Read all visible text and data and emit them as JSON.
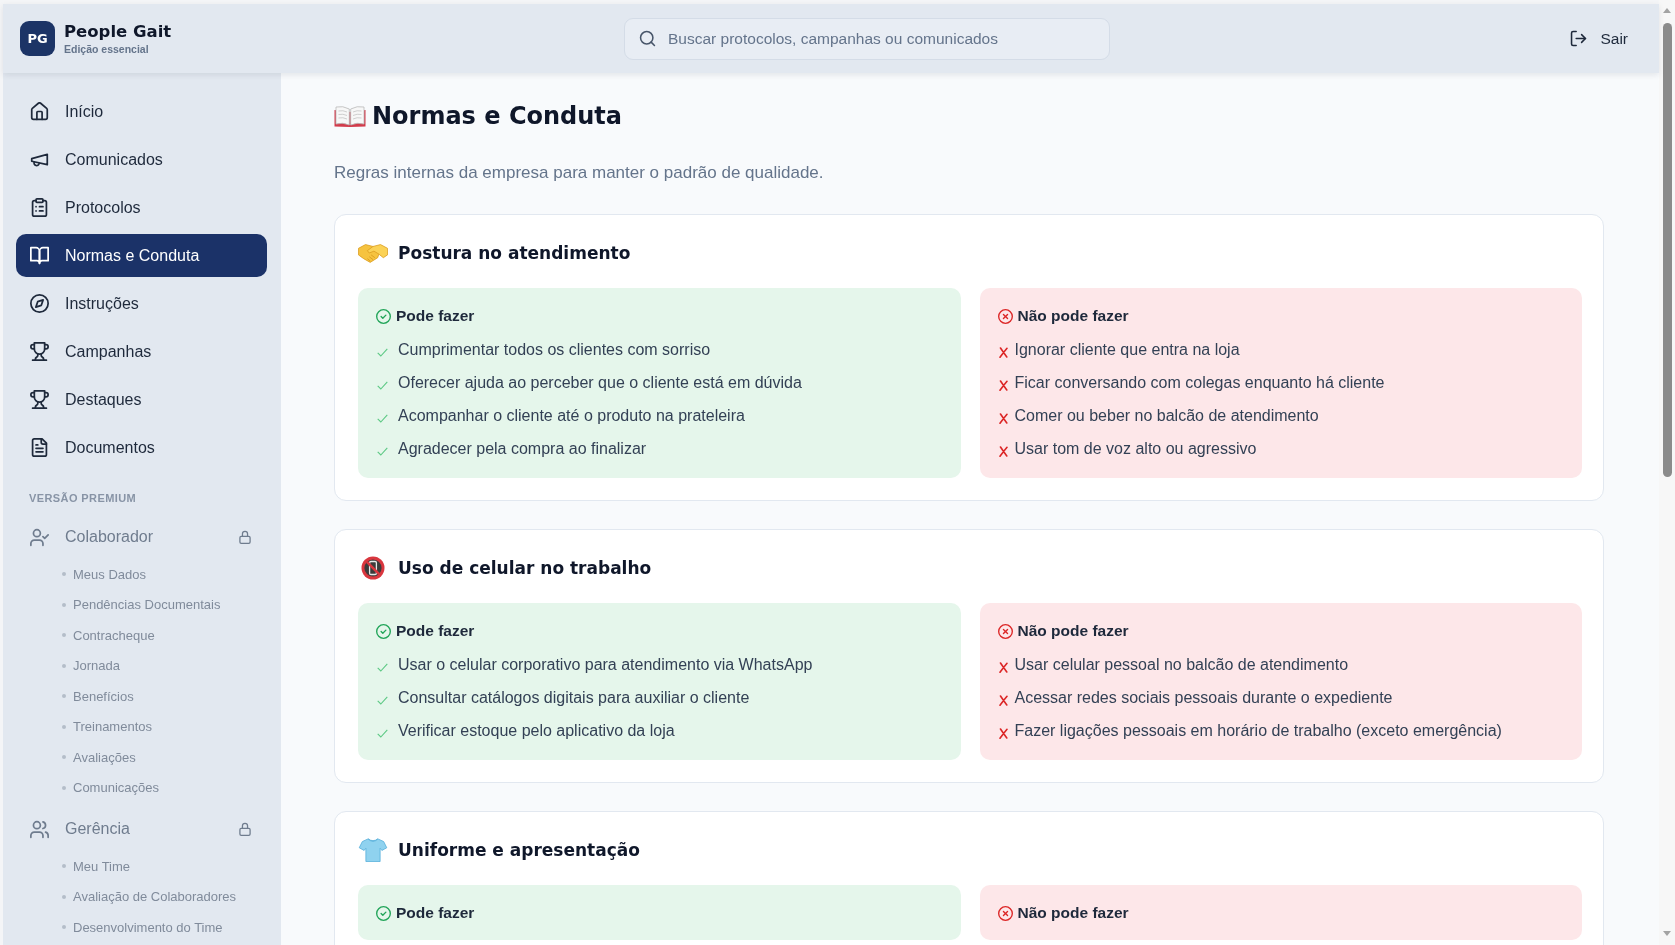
{
  "header": {
    "logo": {
      "initials": "PG",
      "name": "People Gait",
      "edition": "Edição essencial"
    },
    "search": {
      "placeholder": "Buscar protocolos, campanhas ou comunicados"
    },
    "logout": {
      "label": "Sair"
    }
  },
  "sidebar": {
    "items": [
      {
        "label": "Início",
        "selected": false
      },
      {
        "label": "Comunicados",
        "selected": false
      },
      {
        "label": "Protocolos",
        "selected": false
      },
      {
        "label": "Normas e Conduta",
        "selected": true
      },
      {
        "label": "Instruções",
        "selected": false
      },
      {
        "label": "Campanhas",
        "selected": false
      },
      {
        "label": "Destaques",
        "selected": false
      },
      {
        "label": "Documentos",
        "selected": false
      }
    ],
    "premium": {
      "heading": "VERSÃO PREMIUM",
      "groups": [
        {
          "label": "Colaborador",
          "locked": true,
          "children": [
            {
              "label": "Meus Dados"
            },
            {
              "label": "Pendências Documentais"
            },
            {
              "label": "Contracheque"
            },
            {
              "label": "Jornada"
            },
            {
              "label": "Benefícios"
            },
            {
              "label": "Treinamentos"
            },
            {
              "label": "Avaliações"
            },
            {
              "label": "Comunicações"
            }
          ]
        },
        {
          "label": "Gerência",
          "locked": true,
          "children": [
            {
              "label": "Meu Time"
            },
            {
              "label": "Avaliação de Colaboradores"
            },
            {
              "label": "Desenvolvimento do Time"
            }
          ]
        }
      ]
    }
  },
  "page": {
    "title": "Normas e Conduta",
    "subtitle": "Regras internas da empresa para manter o padrão de qualidade.",
    "sections": [
      {
        "title": "Postura no atendimento",
        "panels": [
          {
            "kind": "allowed",
            "title": "Pode fazer",
            "items": [
              "Cumprimentar todos os clientes com sorriso",
              "Oferecer ajuda ao perceber que o cliente está em dúvida",
              "Acompanhar o cliente até o produto na prateleira",
              "Agradecer pela compra ao finalizar"
            ]
          },
          {
            "kind": "forbidden",
            "title": "Não pode fazer",
            "items": [
              "Ignorar cliente que entra na loja",
              "Ficar conversando com colegas enquanto há cliente",
              "Comer ou beber no balcão de atendimento",
              "Usar tom de voz alto ou agressivo"
            ]
          }
        ]
      },
      {
        "title": "Uso de celular no trabalho",
        "panels": [
          {
            "kind": "allowed",
            "title": "Pode fazer",
            "items": [
              "Usar o celular corporativo para atendimento via WhatsApp",
              "Consultar catálogos digitais para auxiliar o cliente",
              "Verificar estoque pelo aplicativo da loja"
            ]
          },
          {
            "kind": "forbidden",
            "title": "Não pode fazer",
            "items": [
              "Usar celular pessoal no balcão de atendimento",
              "Acessar redes sociais pessoais durante o expediente",
              "Fazer ligações pessoais em horário de trabalho (exceto emergência)"
            ]
          }
        ]
      },
      {
        "title": "Uniforme e apresentação",
        "panels": [
          {
            "kind": "allowed",
            "title": "Pode fazer"
          },
          {
            "kind": "forbidden",
            "title": "Não pode fazer"
          }
        ]
      }
    ]
  }
}
